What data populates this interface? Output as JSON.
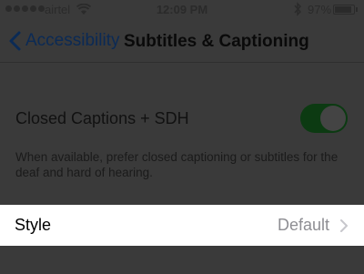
{
  "status_bar": {
    "carrier": "airtel",
    "time": "12:09 PM",
    "battery_percent": "97%",
    "battery_level": 0.97,
    "signal_icon": "signal-dots-icon",
    "wifi_icon": "wifi-icon",
    "bluetooth_icon": "bluetooth-icon",
    "battery_icon": "battery-icon"
  },
  "nav": {
    "back_label": "Accessibility",
    "title": "Subtitles & Captioning",
    "back_icon": "chevron-left-icon"
  },
  "closed_captions": {
    "label": "Closed Captions + SDH",
    "enabled": true,
    "footer": "When available, prefer closed captioning or subtitles for the deaf and hard of hearing."
  },
  "style": {
    "label": "Style",
    "value": "Default",
    "chevron_icon": "chevron-right-icon"
  },
  "colors": {
    "dim_overlay": "#3a3a3a",
    "highlight_row": "#ffffff",
    "toggle_on": "#0c3a12",
    "accent": "#0b2a55",
    "secondary_text": "#8e8e93"
  }
}
